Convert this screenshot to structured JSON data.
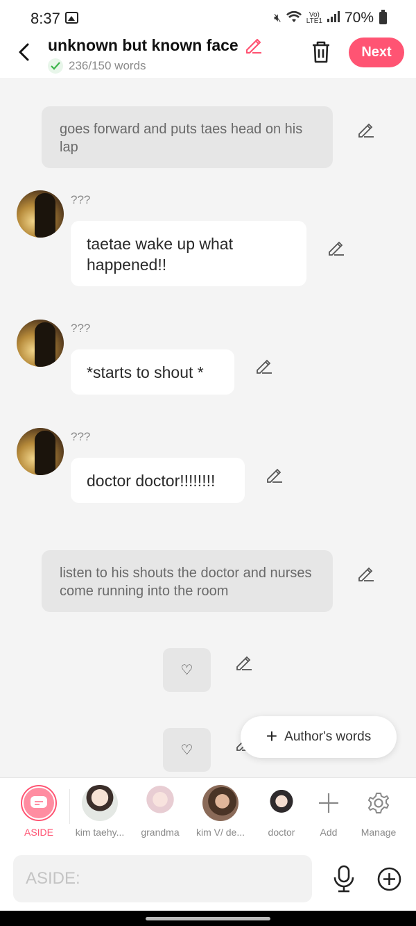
{
  "status": {
    "time": "8:37",
    "battery": "70%"
  },
  "header": {
    "title": "unknown but known face",
    "word_count": "236/150 words",
    "next_label": "Next"
  },
  "messages": [
    {
      "type": "aside",
      "text": "goes forward and puts taes head on his lap"
    },
    {
      "type": "chat",
      "speaker": "???",
      "text": "taetae wake up what happened!!"
    },
    {
      "type": "chat",
      "speaker": "???",
      "text": "*starts to shout *"
    },
    {
      "type": "chat",
      "speaker": "???",
      "text": "doctor doctor!!!!!!!!"
    },
    {
      "type": "aside",
      "text": "listen to his shouts the doctor and nurses come running into the room"
    },
    {
      "type": "reaction",
      "text": "♡"
    },
    {
      "type": "reaction",
      "text": "♡"
    }
  ],
  "authors_words_label": "Author's words",
  "characters": [
    {
      "name": "ASIDE",
      "selected": true
    },
    {
      "name": "kim taehy..."
    },
    {
      "name": "grandma"
    },
    {
      "name": "kim V/ de..."
    },
    {
      "name": "doctor"
    }
  ],
  "tools": [
    {
      "name": "Add",
      "icon": "plus-icon"
    },
    {
      "name": "Manage",
      "icon": "gear-icon"
    }
  ],
  "input": {
    "placeholder": "ASIDE:"
  },
  "colors": {
    "accent": "#ff5473",
    "aside_bubble": "#e6e6e6",
    "background": "#f4f4f4"
  }
}
